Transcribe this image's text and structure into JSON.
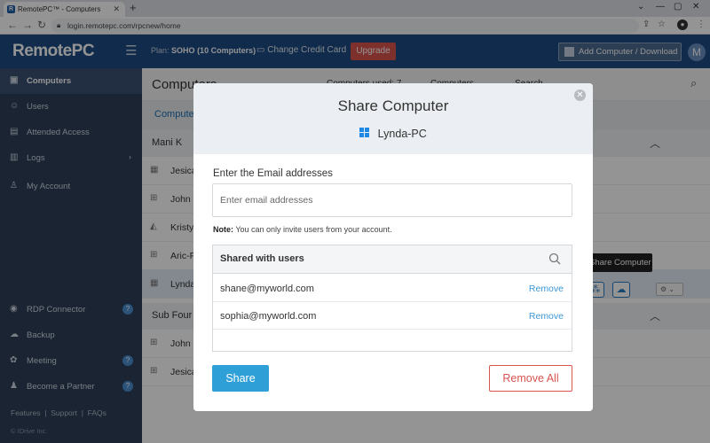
{
  "browser": {
    "tab_title": "RemotePC™ - Computers",
    "tab_favicon": "R",
    "url": "login.remotepc.com/rpcnew/home",
    "account_initial": "M"
  },
  "topbar": {
    "logo": "RemotePC",
    "plan_prefix": "Plan:",
    "plan_name": "SOHO",
    "plan_detail": "(10 Computers)",
    "change_credit_card": "Change Credit Card",
    "upgrade": "Upgrade",
    "add_computer": "Add Computer / Download",
    "avatar": "M"
  },
  "sidebar": {
    "items": [
      {
        "label": "Computers",
        "icon": "monitor-icon"
      },
      {
        "label": "Users",
        "icon": "users-icon"
      },
      {
        "label": "Attended Access",
        "icon": "attended-icon"
      },
      {
        "label": "Logs",
        "icon": "logs-icon"
      },
      {
        "label": "My Account",
        "icon": "account-icon"
      }
    ],
    "tools": [
      {
        "label": "RDP Connector",
        "icon": "rdp-icon"
      },
      {
        "label": "Backup",
        "icon": "backup-icon"
      },
      {
        "label": "Meeting",
        "icon": "meeting-icon"
      },
      {
        "label": "Become a Partner",
        "icon": "partner-icon"
      }
    ],
    "footer_links": [
      "Features",
      "Support",
      "FAQs"
    ],
    "copyright": "© IDrive Inc."
  },
  "main": {
    "title": "Computers",
    "computers_used": "Computers used: 7",
    "col_computers": "Computers",
    "search_label": "Search",
    "sub_tab": "Computers",
    "groups": [
      {
        "name": "Mani K",
        "rows": [
          "Jesica",
          "John",
          "Kristy",
          "Aric-PC",
          "Lynda-PC"
        ]
      },
      {
        "name": "Sub Four",
        "rows": [
          "John",
          "Jesica"
        ]
      }
    ],
    "tooltip": "Share Computer"
  },
  "modal": {
    "title": "Share Computer",
    "computer_name": "Lynda-PC",
    "email_label": "Enter the Email addresses",
    "email_placeholder": "Enter email addresses",
    "note_label": "Note:",
    "note_text": "You can only invite users from your account.",
    "shared_header": "Shared with users",
    "shared_users": [
      {
        "email": "shane@myworld.com",
        "action": "Remove"
      },
      {
        "email": "sophia@myworld.com",
        "action": "Remove"
      }
    ],
    "share_button": "Share",
    "remove_all_button": "Remove All",
    "colors": {
      "primary": "#2f9fd8",
      "danger": "#d9534f",
      "header_bg": "#1c4a82",
      "sidebar_bg": "#2d3f57"
    }
  }
}
